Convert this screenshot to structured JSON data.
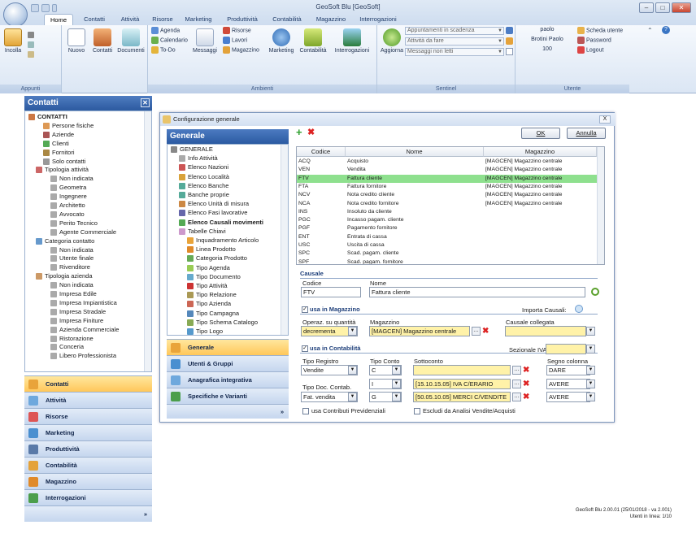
{
  "app": {
    "title": "GeoSoft Blu [GeoSoft]"
  },
  "tabs": [
    "Home",
    "Contatti",
    "Attività",
    "Risorse",
    "Marketing",
    "Produttività",
    "Contabilità",
    "Magazzino",
    "Interrogazioni"
  ],
  "ribbon": {
    "appunti": {
      "label": "Appunti",
      "incolla": "Incolla"
    },
    "nuovo": "Nuovo",
    "contatti": "Contatti",
    "documenti": "Documenti",
    "agenda": "Agenda",
    "calendario": "Calendario",
    "todo": "To-Do",
    "messaggi": "Messaggi",
    "risorse": "Risorse",
    "lavori": "Lavori",
    "magazzino": "Magazzino",
    "marketing": "Marketing",
    "contabilita": "Contabilità",
    "interrogazioni": "Interrogazioni",
    "ambienti_label": "Ambienti",
    "aggiorna": "Aggiorna",
    "sentinel": {
      "label": "Sentinel",
      "combo1": "Appuntamenti in scadenza",
      "combo2": "Attività da fare",
      "combo3": "Messaggi non letti"
    },
    "utente": {
      "label": "Utente",
      "user": "paolo",
      "name": "Brotini Paolo",
      "num": "100",
      "scheda": "Scheda utente",
      "password": "Password",
      "logout": "Logout"
    }
  },
  "left": {
    "header": "Contatti",
    "tree": [
      "CONTATTI",
      "Persone fisiche",
      "Aziende",
      "Clienti",
      "Fornitori",
      "Solo contatti",
      "Tipologia attività",
      "Non indicata",
      "Geometra",
      "Ingegnere",
      "Architetto",
      "Avvocato",
      "Perito Tecnico",
      "Agente Commerciale",
      "Categoria contatto",
      "Non indicata",
      "Utente finale",
      "Rivenditore",
      "Tipologia azienda",
      "Non indicata",
      "Impresa Edile",
      "Impresa Impiantistica",
      "Impresa Stradale",
      "Impresa Finiture",
      "Azienda Commerciale",
      "Ristorazione",
      "Conceria",
      "Libero Professionista"
    ],
    "nav": [
      "Contatti",
      "Attività",
      "Risorse",
      "Marketing",
      "Produttività",
      "Contabilità",
      "Magazzino",
      "Interrogazioni"
    ],
    "more": "»"
  },
  "dialog": {
    "title": "Configurazione generale",
    "close": "X",
    "gen_header": "Generale",
    "gen_tree": [
      "GENERALE",
      "Info Attività",
      "Elenco Nazioni",
      "Elenco Località",
      "Elenco Banche",
      "Banche proprie",
      "Elenco Unità di misura",
      "Elenco Fasi lavorative",
      "Elenco Causali movimenti",
      "Tabelle Chiavi",
      "Inquadramento Articolo",
      "Linea Prodotto",
      "Categoria Prodotto",
      "Tipo Agenda",
      "Tipo Documento",
      "Tipo Attività",
      "Tipo Relazione",
      "Tipo Azienda",
      "Tipo Campagna",
      "Tipo Schema Catalogo",
      "Tipo Logo"
    ],
    "sections": [
      "Generale",
      "Utenti & Gruppi",
      "Anagrafica integrativa",
      "Specifiche e Varianti"
    ],
    "more": "»",
    "ok": "OK",
    "annulla": "Annulla",
    "add": "+",
    "del": "✖",
    "grid": {
      "headers": [
        "Codice",
        "Nome",
        "Magazzino"
      ],
      "rows": [
        [
          "ACQ",
          "Acquisto",
          "[MAGCEN] Magazzino centrale"
        ],
        [
          "VEN",
          "Vendita",
          "[MAGCEN] Magazzino centrale"
        ],
        [
          "FTV",
          "Fattura cliente",
          "[MAGCEN] Magazzino centrale"
        ],
        [
          "FTA",
          "Fattura fornitore",
          "[MAGCEN] Magazzino centrale"
        ],
        [
          "NCV",
          "Nota credito cliente",
          "[MAGCEN] Magazzino centrale"
        ],
        [
          "NCA",
          "Nota credito fornitore",
          "[MAGCEN] Magazzino centrale"
        ],
        [
          "INS",
          "Insoluto da cliente",
          ""
        ],
        [
          "PGC",
          "Incasso pagam. cliente",
          ""
        ],
        [
          "PGF",
          "Pagamento fornitore",
          ""
        ],
        [
          "ENT",
          "Entrata di cassa",
          ""
        ],
        [
          "USC",
          "Uscita di cassa",
          ""
        ],
        [
          "SPC",
          "Scad. pagam. cliente",
          ""
        ],
        [
          "SPF",
          "Scad. pagam. fornitore",
          ""
        ]
      ],
      "selected_index": 2
    },
    "causale": {
      "section": "Causale",
      "codice_lbl": "Codice",
      "nome_lbl": "Nome",
      "codice": "FTV",
      "nome": "Fattura cliente",
      "usa_mag": "usa in Magazzino",
      "importa": "Importa Causali:",
      "operaz_lbl": "Operaz. su quantità",
      "operaz": "decrementa",
      "mag_lbl": "Magazzino",
      "mag": "[MAGCEN] Magazzino centrale",
      "collegata_lbl": "Causale collegata",
      "collegata": "",
      "usa_cont": "usa in Contabilità",
      "sez_iva_lbl": "Sezionale IVA:",
      "sez_iva": "",
      "tipo_reg_lbl": "Tipo Registro",
      "tipo_reg": "Vendite",
      "tipo_conto_lbl": "Tipo Conto",
      "tipo_conto1": "C",
      "tipo_conto2": "I",
      "tipo_conto3": "G",
      "sottoconto_lbl": "Sottoconto",
      "sottoconto1": "",
      "sottoconto2": "[15.10.15.05] IVA C/ERARIO",
      "sottoconto3": "[50.05.10.05] MERCI C/VENDITE",
      "segno_lbl": "Segno colonna",
      "segno1": "DARE",
      "segno2": "AVERE",
      "segno3": "AVERE",
      "tipo_doc_lbl": "Tipo Doc. Contab.",
      "tipo_doc": "Fat. vendita",
      "contributi": "usa Contributi Previdenziali",
      "escludi": "Escludi da Analisi Vendite/Acquisti"
    }
  },
  "status": {
    "version": "GeoSoft Blu 2.00.01 (25/01/2018 - va 2.001)",
    "online": "Utenti in linea: 1/10"
  }
}
